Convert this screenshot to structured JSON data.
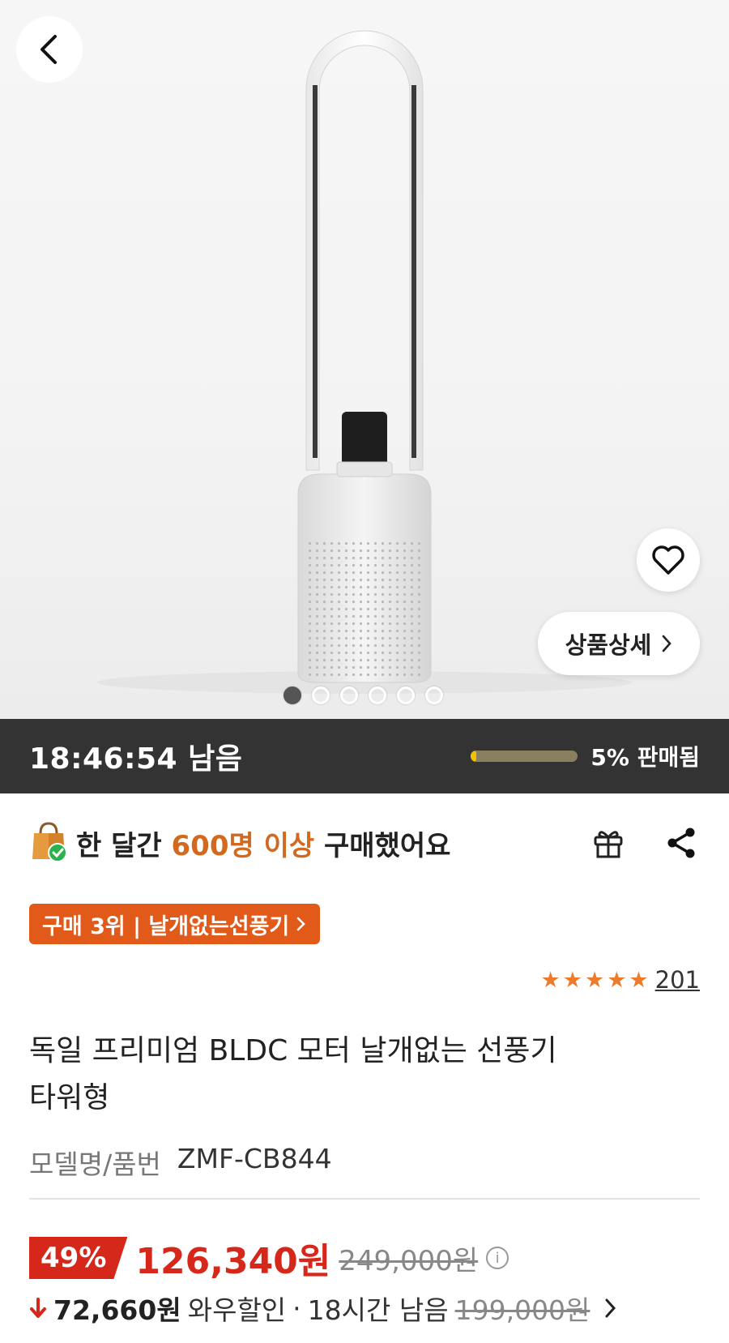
{
  "hero": {
    "detail_label": "상품상세",
    "dot_count": 6,
    "active_dot": 0
  },
  "timer": {
    "remaining": "18:46:54 남음",
    "sold_label": "5% 판매됨",
    "sold_fraction": 0.05
  },
  "purchase": {
    "prefix": "한 달간 ",
    "highlight": "600명 이상",
    "suffix": " 구매했어요"
  },
  "rank_badge": "구매 3위 | 날개없는선풍기",
  "rating": {
    "stars": 5,
    "review_count": "201"
  },
  "product": {
    "title_line1": "독일 프리미엄 BLDC 모터 날개없는 선풍기",
    "title_line2": "타워형",
    "model_label": "모델명/품번",
    "model_value": "ZMF-CB844"
  },
  "price": {
    "discount": "49%",
    "sale": "126,340원",
    "original": "249,000원"
  },
  "wow": {
    "amount": "72,660원",
    "label": "와우할인",
    "separator": "·",
    "time": "18시간 남음",
    "original": "199,000원"
  },
  "colors": {
    "accent": "#e15a1a",
    "price_red": "#d6281a",
    "timer_bg": "#333333",
    "progress": "#f2c200"
  }
}
